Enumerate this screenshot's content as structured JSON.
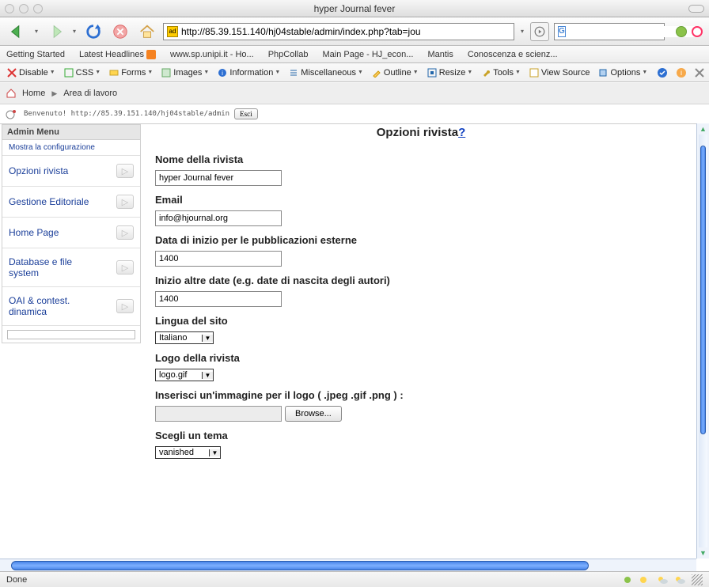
{
  "window": {
    "title": "hyper Journal fever"
  },
  "navbar": {
    "url": "http://85.39.151.140/hj04stable/admin/index.php?tab=jou",
    "search_placeholder": ""
  },
  "bookmarks": [
    "Getting Started",
    "Latest Headlines",
    "www.sp.unipi.it - Ho...",
    "PhpCollab",
    "Main Page - HJ_econ...",
    "Mantis",
    "Conoscenza e scienz..."
  ],
  "devbar": {
    "disable": "Disable",
    "css": "CSS",
    "forms": "Forms",
    "images": "Images",
    "information": "Information",
    "miscellaneous": "Miscellaneous",
    "outline": "Outline",
    "resize": "Resize",
    "tools": "Tools",
    "view_source": "View Source",
    "options": "Options"
  },
  "breadcrumb": {
    "home": "Home",
    "area": "Area di lavoro"
  },
  "welcome": {
    "text": "Benvenuto! http://85.39.151.140/hj04stable/admin",
    "exit": "Esci"
  },
  "sidebar": {
    "title": "Admin Menu",
    "show_config": "Mostra la configurazione",
    "items": [
      "Opzioni rivista",
      "Gestione Editoriale",
      "Home Page",
      "Database e file system",
      "OAI & contest. dinamica"
    ]
  },
  "main": {
    "title": "Opzioni rivista",
    "help": "?",
    "labels": {
      "name": "Nome della rivista",
      "email": "Email",
      "startdate": "Data di inizio per le pubblicazioni esterne",
      "otherdates": "Inizio altre date (e.g. date di nascita degli autori)",
      "lang": "Lingua del sito",
      "logo": "Logo della rivista",
      "upload": "Inserisci un'immagine per il logo ( .jpeg .gif .png ) :",
      "theme": "Scegli un tema",
      "browse": "Browse..."
    },
    "values": {
      "name": "hyper Journal fever",
      "email": "info@hjournal.org",
      "startdate": "1400",
      "otherdates": "1400",
      "lang": "Italiano",
      "logo": "logo.gif",
      "theme": "vanished"
    }
  },
  "status": {
    "done": "Done"
  }
}
